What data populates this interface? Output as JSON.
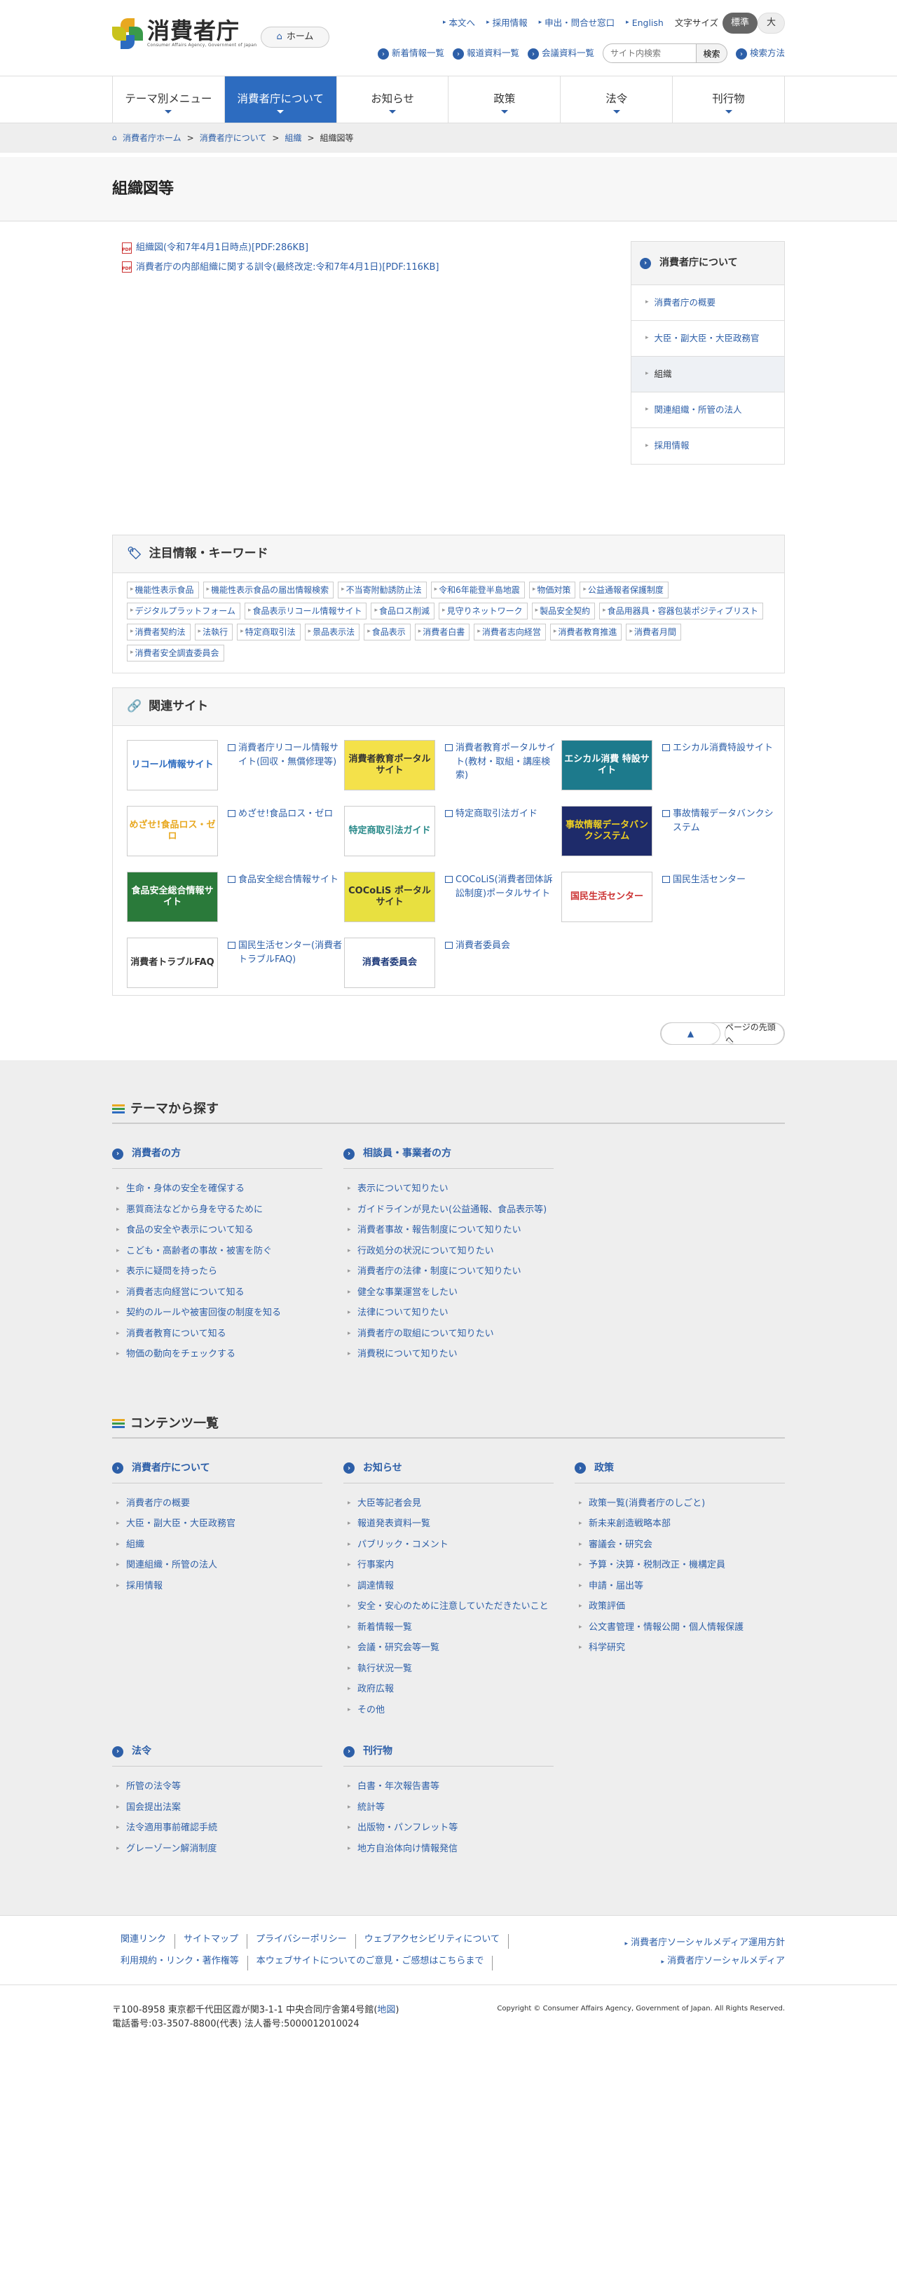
{
  "header": {
    "logo_title": "消費者庁",
    "logo_sub": "Consumer Affairs Agency, Government of Japan",
    "home": "ホーム",
    "top_links": [
      "本文へ",
      "採用情報",
      "申出・問合せ窓口",
      "English"
    ],
    "fontsize_label": "文字サイズ",
    "fs_std": "標準",
    "fs_large": "大",
    "sub_links": [
      "新着情報一覧",
      "報道資料一覧",
      "会議資料一覧"
    ],
    "search_placeholder": "サイト内検索",
    "search_button": "検索",
    "search_method": "検索方法"
  },
  "nav": [
    "テーマ別メニュー",
    "消費者庁について",
    "お知らせ",
    "政策",
    "法令",
    "刊行物"
  ],
  "breadcrumb": [
    "消費者庁ホーム",
    "消費者庁について",
    "組織",
    "組織図等"
  ],
  "page_title": "組織図等",
  "pdfs": [
    "組織図(令和7年4月1日時点)[PDF:286KB]",
    "消費者庁の内部組織に関する訓令(最終改定:令和7年4月1日)[PDF:116KB]"
  ],
  "side": {
    "title": "消費者庁について",
    "items": [
      "消費者庁の概要",
      "大臣・副大臣・大臣政務官",
      "組織",
      "関連組織・所管の法人",
      "採用情報"
    ]
  },
  "keywords": {
    "title": "注目情報・キーワード",
    "tags": [
      "機能性表示食品",
      "機能性表示食品の届出情報検索",
      "不当寄附勧誘防止法",
      "令和6年能登半島地震",
      "物価対策",
      "公益通報者保護制度",
      "デジタルプラットフォーム",
      "食品表示リコール情報サイト",
      "食品ロス削減",
      "見守りネットワーク",
      "製品安全契約",
      "食品用器具・容器包装ポジティブリスト",
      "消費者契約法",
      "法執行",
      "特定商取引法",
      "景品表示法",
      "食品表示",
      "消費者白書",
      "消費者志向経営",
      "消費者教育推進",
      "消費者月間",
      "消費者安全調査委員会"
    ]
  },
  "sites": {
    "title": "関連サイト",
    "items": [
      {
        "banner": "リコール情報サイト",
        "text": "消費者庁リコール情報サイト(回収・無償修理等)"
      },
      {
        "banner": "消費者教育ポータルサイト",
        "text": "消費者教育ポータルサイト(教材・取組・講座検索)"
      },
      {
        "banner": "エシカル消費 特設サイト",
        "text": "エシカル消費特設サイト"
      },
      {
        "banner": "めざせ!食品ロス・ゼロ",
        "text": "めざせ!食品ロス・ゼロ"
      },
      {
        "banner": "特定商取引法ガイド",
        "text": "特定商取引法ガイド"
      },
      {
        "banner": "事故情報データバンクシステム",
        "text": "事故情報データバンクシステム"
      },
      {
        "banner": "食品安全総合情報サイト",
        "text": "食品安全総合情報サイト"
      },
      {
        "banner": "COCoLiS ポータルサイト",
        "text": "COCoLiS(消費者団体訴訟制度)ポータルサイト"
      },
      {
        "banner": "国民生活センター",
        "text": "国民生活センター"
      },
      {
        "banner": "消費者トラブルFAQ",
        "text": "国民生活センター(消費者トラブルFAQ)"
      },
      {
        "banner": "消費者委員会",
        "text": "消費者委員会"
      }
    ]
  },
  "pagetop": "ページの先頭へ",
  "theme": {
    "title": "テーマから探す",
    "cols": [
      {
        "title": "消費者の方",
        "items": [
          "生命・身体の安全を確保する",
          "悪質商法などから身を守るために",
          "食品の安全や表示について知る",
          "こども・高齢者の事故・被害を防ぐ",
          "表示に疑問を持ったら",
          "消費者志向経営について知る",
          "契約のルールや被害回復の制度を知る",
          "消費者教育について知る",
          "物価の動向をチェックする"
        ]
      },
      {
        "title": "相談員・事業者の方",
        "items": [
          "表示について知りたい",
          "ガイドラインが見たい(公益通報、食品表示等)",
          "消費者事故・報告制度について知りたい",
          "行政処分の状況について知りたい",
          "消費者庁の法律・制度について知りたい",
          "健全な事業運営をしたい",
          "法律について知りたい",
          "消費者庁の取組について知りたい",
          "消費税について知りたい"
        ]
      }
    ]
  },
  "contents": {
    "title": "コンテンツ一覧",
    "cols": [
      {
        "title": "消費者庁について",
        "items": [
          "消費者庁の概要",
          "大臣・副大臣・大臣政務官",
          "組織",
          "関連組織・所管の法人",
          "採用情報"
        ]
      },
      {
        "title": "お知らせ",
        "items": [
          "大臣等記者会見",
          "報道発表資料一覧",
          "パブリック・コメント",
          "行事案内",
          "調達情報",
          "安全・安心のために注意していただきたいこと",
          "新着情報一覧",
          "会議・研究会等一覧",
          "執行状況一覧",
          "政府広報",
          "その他"
        ]
      },
      {
        "title": "政策",
        "items": [
          "政策一覧(消費者庁のしごと)",
          "新未来創造戦略本部",
          "審議会・研究会",
          "予算・決算・税制改正・機構定員",
          "申請・届出等",
          "政策評価",
          "公文書管理・情報公開・個人情報保護",
          "科学研究"
        ]
      },
      {
        "title": "法令",
        "items": [
          "所管の法令等",
          "国会提出法案",
          "法令適用事前確認手続",
          "グレーゾーン解消制度"
        ]
      },
      {
        "title": "刊行物",
        "items": [
          "白書・年次報告書等",
          "統計等",
          "出版物・パンフレット等",
          "地方自治体向け情報発信"
        ]
      }
    ]
  },
  "footer": {
    "links": [
      "関連リンク",
      "サイトマップ",
      "プライバシーポリシー",
      "ウェブアクセシビリティについて",
      "利用規約・リンク・著作権等",
      "本ウェブサイトについてのご意見・ご感想はこちらまで"
    ],
    "right_links": [
      "消費者庁ソーシャルメディア運用方針",
      "消費者庁ソーシャルメディア"
    ],
    "address": "〒100-8958 東京都千代田区霞が関3-1-1 中央合同庁舎第4号館(",
    "map": "地図",
    "address_end": ")",
    "phone": "電話番号:03-3507-8800(代表)  法人番号:5000012010024",
    "copyright": "Copyright © Consumer Affairs Agency, Government of Japan. All Rights Reserved."
  }
}
